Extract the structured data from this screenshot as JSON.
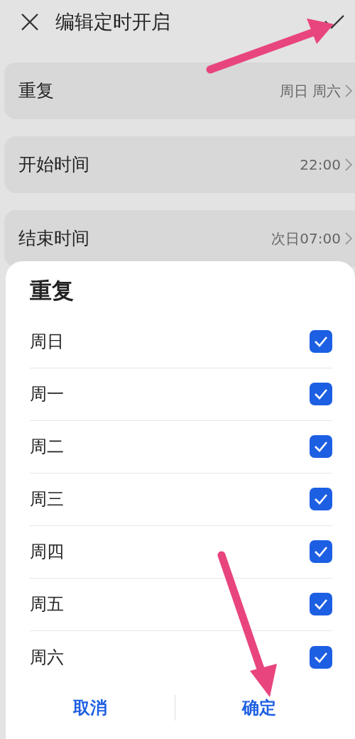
{
  "header": {
    "title": "编辑定时开启"
  },
  "settings": [
    {
      "label": "重复",
      "value": "周日 周六"
    },
    {
      "label": "开始时间",
      "value": "22:00"
    },
    {
      "label": "结束时间",
      "value": "次日07:00"
    }
  ],
  "dialog": {
    "title": "重复",
    "days": [
      {
        "label": "周日",
        "checked": true
      },
      {
        "label": "周一",
        "checked": true
      },
      {
        "label": "周二",
        "checked": true
      },
      {
        "label": "周三",
        "checked": true
      },
      {
        "label": "周四",
        "checked": true
      },
      {
        "label": "周五",
        "checked": true
      },
      {
        "label": "周六",
        "checked": true
      }
    ],
    "buttons": [
      "取消",
      "确定"
    ]
  }
}
